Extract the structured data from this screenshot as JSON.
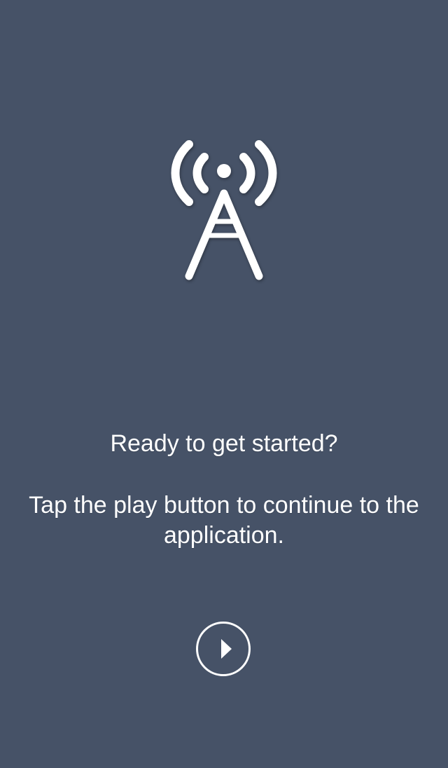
{
  "screen": {
    "background_color": "#465267",
    "text_color": "#ffffff"
  },
  "hero": {
    "icon": "radio-tower-icon"
  },
  "messages": {
    "headline": "Ready to get started?",
    "instruction": "Tap the play button to continue to the application."
  },
  "actions": {
    "play_button_icon": "play-icon"
  }
}
